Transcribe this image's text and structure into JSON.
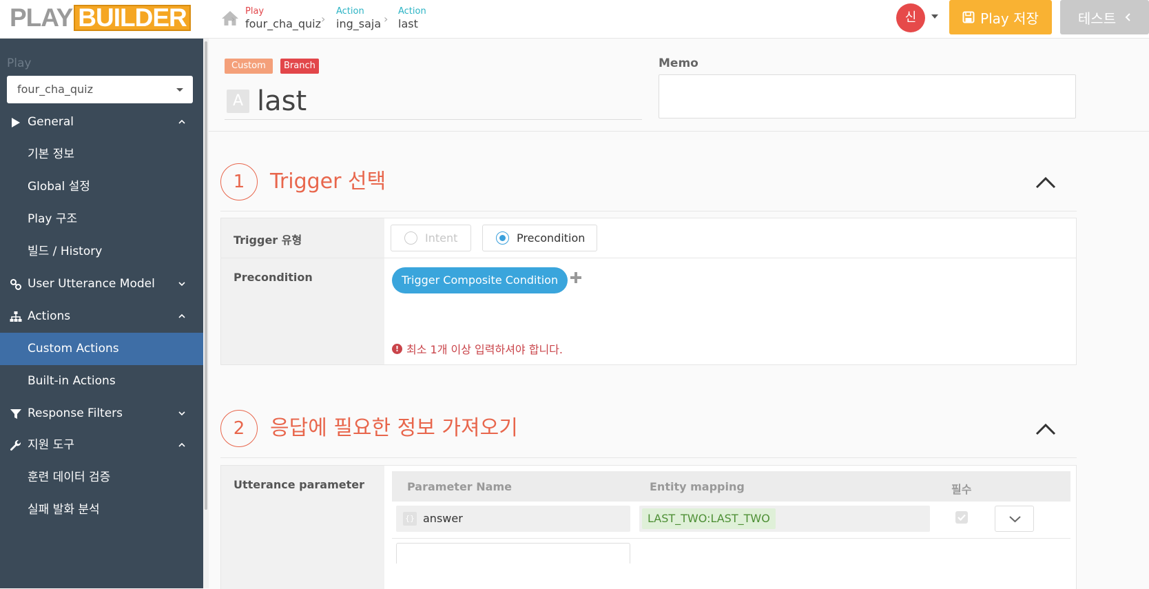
{
  "app": {
    "logo_part1": "PLAY",
    "logo_part2": "BUILDER"
  },
  "breadcrumbs": [
    {
      "kind": "Play",
      "value": "four_cha_quiz",
      "kind_color": "#e2464a"
    },
    {
      "kind": "Action",
      "value": "ing_saja",
      "kind_color": "#2bb3c4"
    },
    {
      "kind": "Action",
      "value": "last",
      "kind_color": "#2bb3c4"
    }
  ],
  "user": {
    "avatar_initial": "신"
  },
  "toolbar": {
    "save_label": "Play 저장",
    "test_label": "테스트"
  },
  "sidebar": {
    "play_label": "Play",
    "play_select": "four_cha_quiz",
    "items": [
      {
        "label": "General",
        "icon": "play-triangle-icon",
        "expanded": true
      },
      {
        "label": "기본 정보"
      },
      {
        "label": "Global 설정"
      },
      {
        "label": "Play 구조"
      },
      {
        "label": "빌드 / History"
      },
      {
        "label": "User Utterance Model",
        "icon": "link-icon",
        "expanded": false
      },
      {
        "label": "Actions",
        "icon": "sitemap-icon",
        "expanded": true
      },
      {
        "label": "Custom Actions",
        "active": true
      },
      {
        "label": "Built-in Actions"
      },
      {
        "label": "Response Filters",
        "icon": "filter-icon",
        "expanded": false
      },
      {
        "label": "지원 도구",
        "icon": "wrench-icon",
        "expanded": true
      },
      {
        "label": "훈련 데이터 검증"
      },
      {
        "label": "실패 발화 분석"
      }
    ]
  },
  "action": {
    "tags": [
      "Custom",
      "Branch"
    ],
    "name_badge": "A",
    "name": "last",
    "memo_label": "Memo",
    "memo_value": ""
  },
  "section1": {
    "number": "1",
    "title": "Trigger 선택",
    "trigger_type_label": "Trigger 유형",
    "options": [
      {
        "label": "Intent",
        "selected": false,
        "disabled": true
      },
      {
        "label": "Precondition",
        "selected": true,
        "disabled": false
      }
    ],
    "precondition_label": "Precondition",
    "precondition_pill": "Trigger Composite Condition",
    "warning": "최소 1개 이상 입력하셔야 합니다."
  },
  "section2": {
    "number": "2",
    "title": "응답에 필요한 정보 가져오기",
    "utterance_label": "Utterance parameter",
    "columns": [
      "Parameter Name",
      "Entity mapping",
      "필수"
    ],
    "rows": [
      {
        "param": "answer",
        "brace": "{}",
        "entity": "LAST_TWO:LAST_TWO",
        "required": true
      }
    ]
  },
  "colors": {
    "accent_orange": "#f9b233",
    "sidebar_bg": "#3b4a58",
    "sidebar_active": "#3e6ea6",
    "section_title": "#e8664c",
    "pill_blue": "#3aa5dc",
    "warning_red": "#c9444a"
  }
}
